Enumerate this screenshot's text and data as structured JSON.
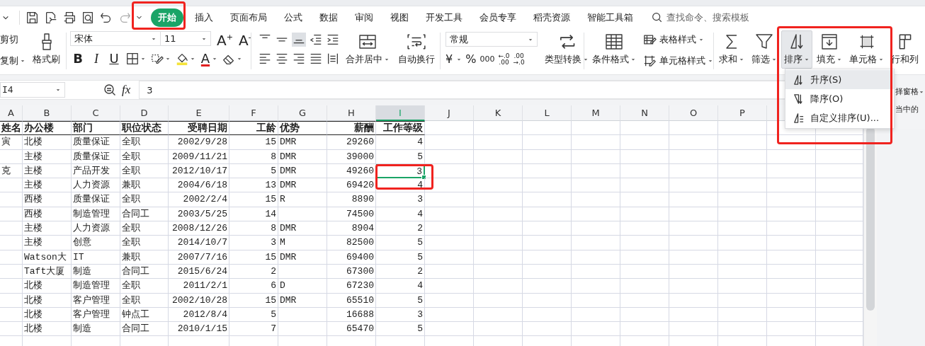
{
  "tabs": [
    {
      "label": "开始",
      "selected": true
    },
    {
      "label": "插入",
      "selected": false
    },
    {
      "label": "页面布局",
      "selected": false
    },
    {
      "label": "公式",
      "selected": false
    },
    {
      "label": "数据",
      "selected": false
    },
    {
      "label": "审阅",
      "selected": false
    },
    {
      "label": "视图",
      "selected": false
    },
    {
      "label": "开发工具",
      "selected": false
    },
    {
      "label": "会员专享",
      "selected": false
    },
    {
      "label": "稻壳资源",
      "selected": false
    },
    {
      "label": "智能工具箱",
      "selected": false
    }
  ],
  "search": {
    "placeholder": "查找命令、搜索模板"
  },
  "ribbon": {
    "clipboard": {
      "cut": "剪切",
      "copy": "复制",
      "format_painter": "格式刷"
    },
    "font": {
      "name": "宋体",
      "size": "11",
      "grow": "A$^{+}$",
      "shrink": "A$^{-}$",
      "bold": "B",
      "italic": "I",
      "underline": "U",
      "color_letter": "A"
    },
    "align_buttons": [
      {
        "kind": "top",
        "selected": false
      },
      {
        "kind": "middle",
        "selected": false
      },
      {
        "kind": "bottom",
        "selected": true
      },
      {
        "kind": "outdent",
        "selected": false
      },
      {
        "kind": "indent",
        "selected": false
      },
      {
        "kind": "left",
        "selected": false
      },
      {
        "kind": "center",
        "selected": false
      },
      {
        "kind": "right",
        "selected": false
      },
      {
        "kind": "justify",
        "selected": false
      },
      {
        "kind": "distributed",
        "selected": false
      }
    ],
    "alignment": {
      "merge": "合并居中",
      "wrap": "自动换行"
    },
    "number": {
      "format": "常规",
      "currency": "¥",
      "percent": "%",
      "thousands": "000",
      "increase_decimal": [
        "←.0",
        ".00"
      ],
      "decrease_decimal": [
        ".00",
        "→.0"
      ],
      "convert": "类型转换"
    },
    "styles": {
      "conditional": "条件格式",
      "table_style": "表格样式",
      "cell_style": "单元格样式"
    },
    "editing": [
      {
        "kind": "sum",
        "label": "求和",
        "caret": true,
        "open": false
      },
      {
        "kind": "filter",
        "label": "筛选",
        "caret": true,
        "open": false
      },
      {
        "kind": "sort",
        "label": "排序",
        "caret": true,
        "open": true
      },
      {
        "kind": "fill",
        "label": "填充",
        "caret": true,
        "open": false
      },
      {
        "kind": "cell",
        "label": "单元格",
        "caret": true,
        "open": false
      },
      {
        "kind": "rowcol",
        "label": "行和列",
        "caret": false,
        "open": false
      }
    ]
  },
  "sort_menu": [
    {
      "kind": "ascending",
      "label": "升序(S)",
      "selected": true
    },
    {
      "kind": "descending",
      "label": "降序(O)",
      "selected": false
    },
    {
      "kind": "custom",
      "label": "自定义排序(U)...",
      "selected": false
    }
  ],
  "formula_bar": {
    "name_box": "I4",
    "fx": "fx",
    "value": "3"
  },
  "side_panel": {
    "items": [
      "择窗格",
      "当中的"
    ]
  },
  "sheet": {
    "columns": [
      {
        "label": "A",
        "kind": "text",
        "selected": false
      },
      {
        "label": "B",
        "kind": "text",
        "selected": false
      },
      {
        "label": "C",
        "kind": "text",
        "selected": false
      },
      {
        "label": "D",
        "kind": "text",
        "selected": false
      },
      {
        "label": "E",
        "kind": "number",
        "selected": false
      },
      {
        "label": "F",
        "kind": "number",
        "selected": false
      },
      {
        "label": "G",
        "kind": "text",
        "selected": false
      },
      {
        "label": "H",
        "kind": "number",
        "selected": false
      },
      {
        "label": "I",
        "kind": "number",
        "selected": true
      },
      {
        "label": "J",
        "kind": "text",
        "selected": false
      },
      {
        "label": "K",
        "kind": "text",
        "selected": false
      },
      {
        "label": "L",
        "kind": "text",
        "selected": false
      },
      {
        "label": "M",
        "kind": "text",
        "selected": false
      },
      {
        "label": "N",
        "kind": "text",
        "selected": false
      },
      {
        "label": "O",
        "kind": "text",
        "selected": false
      },
      {
        "label": "P",
        "kind": "text",
        "selected": false
      }
    ],
    "header_row": [
      "姓名",
      "办公楼",
      "部门",
      "职位状态",
      "受聘日期",
      "工龄",
      "优势",
      "薪酬",
      "工作等级"
    ],
    "rows": [
      {
        "selected": false,
        "cells": [
          "寅",
          "北楼",
          "质量保证",
          "全职",
          "2002/9/28",
          "15",
          "DMR",
          "29260",
          "4"
        ]
      },
      {
        "selected": false,
        "cells": [
          "",
          "主楼",
          "质量保证",
          "全职",
          "2009/11/21",
          "8",
          "DMR",
          "39000",
          "5"
        ]
      },
      {
        "selected": true,
        "cells": [
          "克",
          "主楼",
          "产品开发",
          "全职",
          "2012/10/17",
          "5",
          "DMR",
          "49260",
          "3"
        ]
      },
      {
        "selected": false,
        "cells": [
          "",
          "主楼",
          "人力资源",
          "兼职",
          "2004/6/18",
          "13",
          "DMR",
          "69420",
          "4"
        ]
      },
      {
        "selected": false,
        "cells": [
          "",
          "西楼",
          "质量保证",
          "全职",
          "2002/2/4",
          "15",
          "R",
          "8890",
          "3"
        ]
      },
      {
        "selected": false,
        "cells": [
          "",
          "西楼",
          "制造管理",
          "合同工",
          "2003/5/25",
          "14",
          "",
          "74500",
          "4"
        ]
      },
      {
        "selected": false,
        "cells": [
          "",
          "主楼",
          "人力资源",
          "全职",
          "2008/12/26",
          "8",
          "DMR",
          "8904",
          "2"
        ]
      },
      {
        "selected": false,
        "cells": [
          "",
          "主楼",
          "创意",
          "全职",
          "2014/10/7",
          "3",
          "M",
          "82500",
          "5"
        ]
      },
      {
        "selected": false,
        "cells": [
          "",
          "Watson大",
          "IT",
          "兼职",
          "2007/7/16",
          "15",
          "DMR",
          "69400",
          "5"
        ]
      },
      {
        "selected": false,
        "cells": [
          "",
          "Taft大厦",
          "制造",
          "合同工",
          "2015/6/24",
          "2",
          "",
          "67300",
          "2"
        ]
      },
      {
        "selected": false,
        "cells": [
          "",
          "北楼",
          "制造管理",
          "全职",
          "2011/2/1",
          "6",
          "D",
          "67230",
          "4"
        ]
      },
      {
        "selected": false,
        "cells": [
          "",
          "北楼",
          "客户管理",
          "全职",
          "2002/10/28",
          "15",
          "DMR",
          "65510",
          "5"
        ]
      },
      {
        "selected": false,
        "cells": [
          "",
          "北楼",
          "客户管理",
          "钟点工",
          "2012/8/4",
          "5",
          "",
          "16688",
          "3"
        ]
      },
      {
        "selected": false,
        "cells": [
          "",
          "北楼",
          "制造",
          "合同工",
          "2010/1/15",
          "7",
          "",
          "65470",
          "5"
        ]
      }
    ]
  }
}
